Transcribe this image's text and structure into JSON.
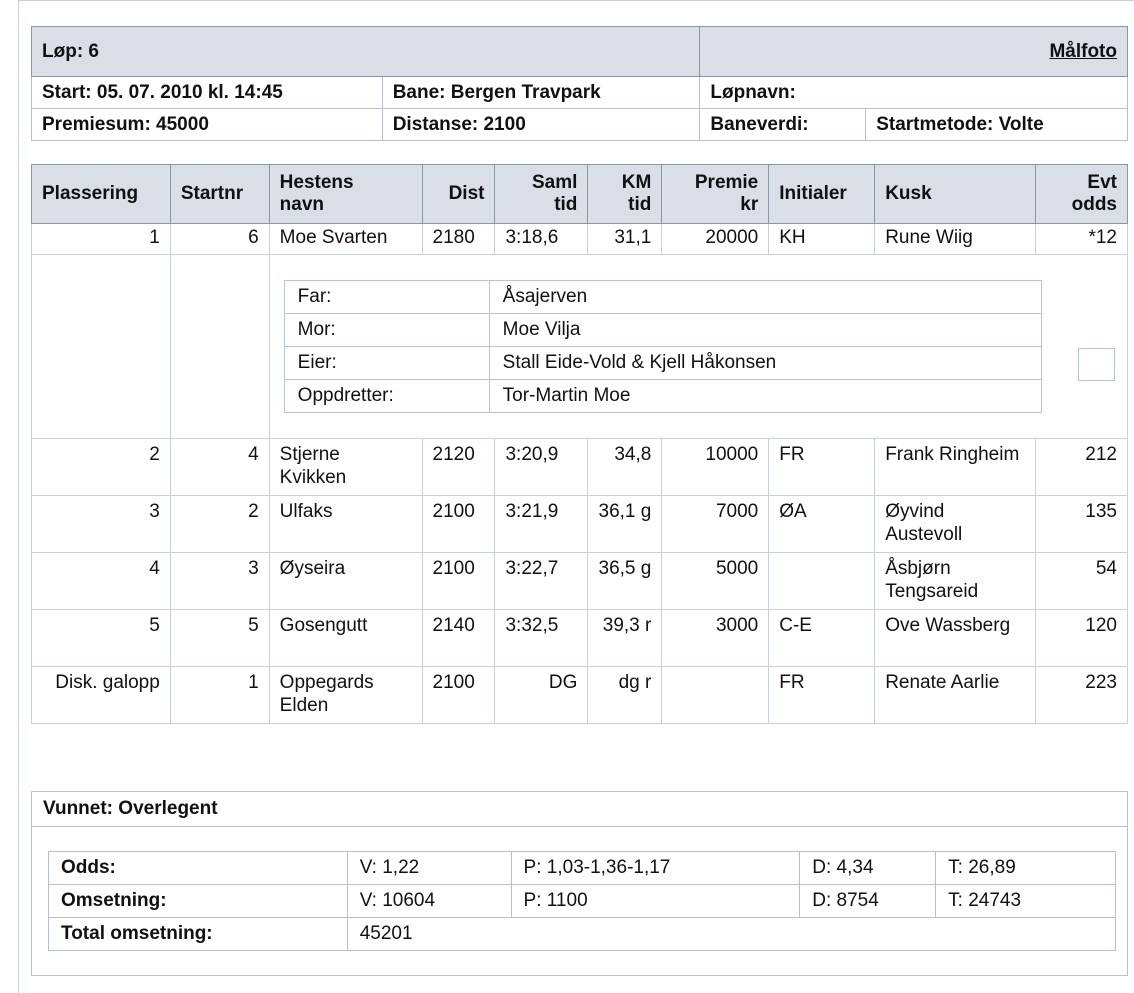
{
  "header": {
    "race_label": "Løp: 6",
    "photo_link": "Målfoto",
    "start": "Start: 05. 07. 2010 kl. 14:45",
    "track": "Bane: Bergen Travpark",
    "race_name": "Løpnavn:",
    "prize_sum": "Premiesum: 45000",
    "distance": "Distanse: 2100",
    "track_value": "Baneverdi:",
    "start_method": "Startmetode: Volte"
  },
  "columns": {
    "placing": "Plassering",
    "startnr": "Startnr",
    "horse_1": "Hestens",
    "horse_2": "navn",
    "dist": "Dist",
    "total_1": "Saml",
    "total_2": "tid",
    "km_1": "KM",
    "km_2": "tid",
    "prize_1": "Premie",
    "prize_2": "kr",
    "initials": "Initialer",
    "driver": "Kusk",
    "odds_1": "Evt",
    "odds_2": "odds"
  },
  "results": [
    {
      "place": "1",
      "startnr": "6",
      "horse": "Moe Svarten",
      "dist": "2180",
      "total": "3:18,6",
      "km": "31,1",
      "prize": "20000",
      "initials": "KH",
      "driver": "Rune Wiig",
      "odds": "*12"
    },
    {
      "place": "2",
      "startnr": "4",
      "horse": "Stjerne Kvikken",
      "dist": "2120",
      "total": "3:20,9",
      "km": "34,8",
      "prize": "10000",
      "initials": "FR",
      "driver": "Frank Ringheim",
      "odds": "212"
    },
    {
      "place": "3",
      "startnr": "2",
      "horse": "Ulfaks",
      "dist": "2100",
      "total": "3:21,9",
      "km": "36,1 g",
      "prize": "7000",
      "initials": "ØA",
      "driver": "Øyvind Austevoll",
      "odds": "135"
    },
    {
      "place": "4",
      "startnr": "3",
      "horse": "Øyseira",
      "dist": "2100",
      "total": "3:22,7",
      "km": "36,5 g",
      "prize": "5000",
      "initials": "",
      "driver": "Åsbjørn Tengsareid",
      "odds": "54"
    },
    {
      "place": "5",
      "startnr": "5",
      "horse": "Gosengutt",
      "dist": "2140",
      "total": "3:32,5",
      "km": "39,3 r",
      "prize": "3000",
      "initials": "C-E",
      "driver": "Ove Wassberg",
      "odds": "120"
    },
    {
      "place": "Disk. galopp",
      "startnr": "1",
      "horse": "Oppegards Elden",
      "dist": "2100",
      "total": "DG",
      "km": "dg r",
      "prize": "",
      "initials": "FR",
      "driver": "Renate Aarlie",
      "odds": "223"
    }
  ],
  "pedigree": [
    {
      "key": "Far:",
      "value": "Åsajerven"
    },
    {
      "key": "Mor:",
      "value": "Moe Vilja"
    },
    {
      "key": "Eier:",
      "value": "Stall Eide-Vold & Kjell Håkonsen"
    },
    {
      "key": "Oppdretter:",
      "value": "Tor-Martin Moe"
    }
  ],
  "summary": {
    "won": "Vunnet: Overlegent",
    "odds_label": "Odds:",
    "odds_v": "V: 1,22",
    "odds_p": "P: 1,03-1,36-1,17",
    "odds_d": "D: 4,34",
    "odds_t": "T: 26,89",
    "turnover_label": "Omsetning:",
    "turnover_v": "V: 10604",
    "turnover_p": "P: 1100",
    "turnover_d": "D: 8754",
    "turnover_t": "T: 24743",
    "total_label": "Total omsetning:",
    "total_value": "45201"
  }
}
